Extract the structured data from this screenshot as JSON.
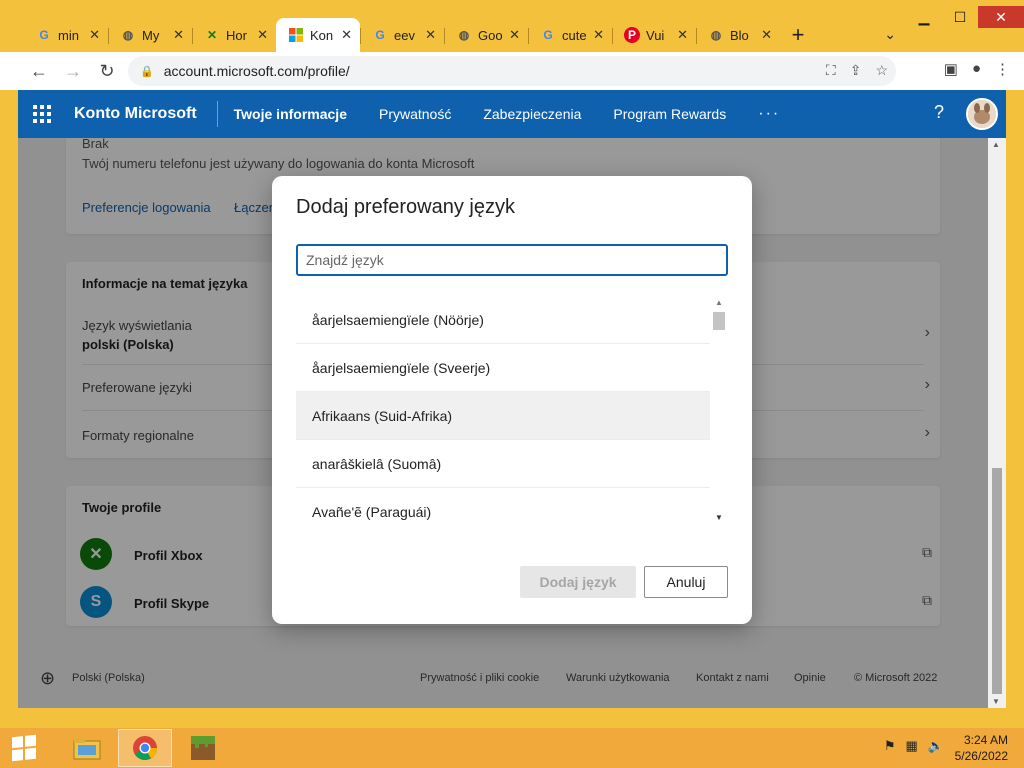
{
  "browser": {
    "tabs": [
      {
        "label": "min",
        "icon": "google-icon",
        "color": "#4285f4"
      },
      {
        "label": "My",
        "icon": "globe-icon",
        "color": "#555555"
      },
      {
        "label": "Hor",
        "icon": "xbox-icon",
        "color": "#107c10"
      },
      {
        "label": "Kon",
        "icon": "microsoft-icon",
        "color": "#f25022",
        "active": true
      },
      {
        "label": "eev",
        "icon": "google-icon",
        "color": "#4285f4"
      },
      {
        "label": "Goo",
        "icon": "globe-icon",
        "color": "#555555"
      },
      {
        "label": "cute",
        "icon": "google-icon",
        "color": "#4285f4"
      },
      {
        "label": "Vui",
        "icon": "pinterest-icon",
        "color": "#e60023"
      },
      {
        "label": "Blo",
        "icon": "globe-icon",
        "color": "#555555"
      }
    ],
    "url": "account.microsoft.com/profile/"
  },
  "header": {
    "brand": "Konto Microsoft",
    "nav": [
      "Twoje informacje",
      "Prywatność",
      "Zabezpieczenia",
      "Program Rewards"
    ],
    "more": "···",
    "help": "?"
  },
  "page": {
    "phone_value": "Brak",
    "phone_note": "Twój numeru telefonu jest używany do logowania do konta Microsoft",
    "link_login_prefs": "Preferencje logowania",
    "link_connect": "Łączer",
    "lang_section_title": "Informacje na temat języka",
    "display_lang_label": "Język wyświetlania",
    "display_lang_value": "polski (Polska)",
    "preferred_langs_label": "Preferowane języki",
    "regional_formats_label": "Formaty regionalne",
    "profiles_title": "Twoje profile",
    "xbox_profile": "Profil Xbox",
    "skype_profile": "Profil Skype"
  },
  "footer": {
    "lang": "Polski (Polska)",
    "links": [
      "Prywatność i pliki cookie",
      "Warunki użytkowania",
      "Kontakt z nami",
      "Opinie",
      "© Microsoft 2022"
    ]
  },
  "dialog": {
    "title": "Dodaj preferowany język",
    "search_placeholder": "Znajdź język",
    "languages": [
      "åarjelsaemiengïele (Nöörje)",
      "åarjelsaemiengïele (Sveerje)",
      "Afrikaans (Suid-Afrika)",
      "anarâškielâ (Suomâ)",
      "Avañe'ẽ (Paraguái)"
    ],
    "add_button": "Dodaj język",
    "cancel_button": "Anuluj"
  },
  "taskbar": {
    "time": "3:24 AM",
    "date": "5/26/2022"
  }
}
